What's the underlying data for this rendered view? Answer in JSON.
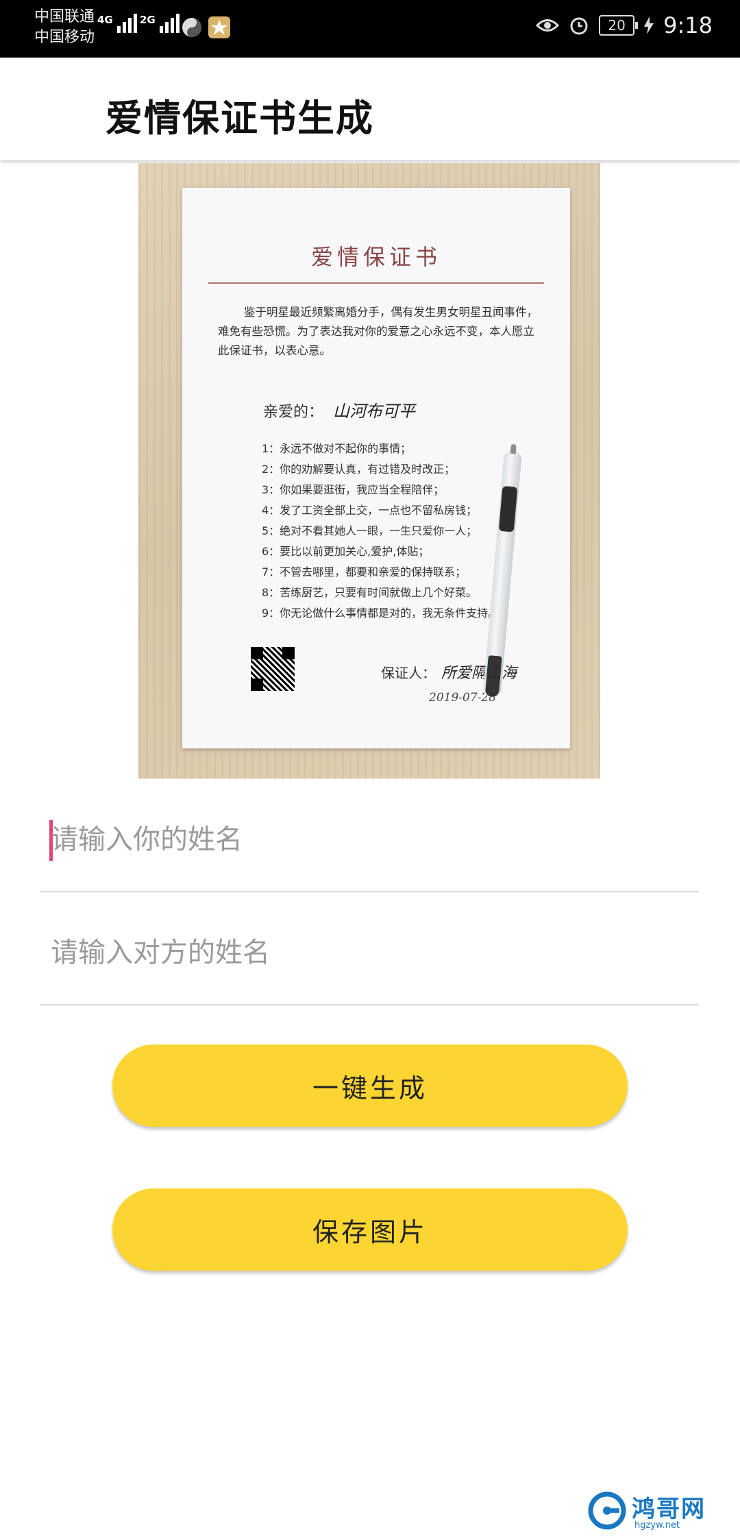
{
  "status_bar": {
    "carrier_1": "中国联通",
    "carrier_2": "中国移动",
    "network_1": "4G",
    "network_2": "2G",
    "battery": "20",
    "time": "9:18",
    "icons": [
      "signal-icon",
      "vpn-icon",
      "app-notification-icon",
      "eye-comfort-icon",
      "alarm-icon",
      "battery-icon",
      "charging-icon"
    ]
  },
  "app_bar": {
    "title": "爱情保证书生成"
  },
  "certificate": {
    "title": "爱情保证书",
    "intro": "鉴于明星最近频繁离婚分手，偶有发生男女明星丑闻事件，难免有些恐慌。为了表达我对你的爱意之心永远不变，本人愿立此保证书，以表心意。",
    "salutation": "亲爱的：",
    "partner_name": "山河布可平",
    "rules": [
      "1：永远不做对不起你的事情；",
      "2：你的劝解要认真，有过错及时改正；",
      "3：你如果要逛街，我应当全程陪伴；",
      "4：发了工资全部上交，一点也不留私房钱；",
      "5：绝对不看其她人一眼，一生只爱你一人；",
      "6：要比以前更加关心,爱护,体贴；",
      "7：不管去哪里，都要和亲爱的保持联系；",
      "8：苦练厨艺，只要有时间就做上几个好菜。",
      "9：你无论做什么事情都是对的，我无条件支持。"
    ],
    "guarantor_label": "保证人：",
    "guarantor_name": "所爱隔山海",
    "date": "2019-07-28"
  },
  "form": {
    "your_name_placeholder": "请输入你的姓名",
    "partner_name_placeholder": "请输入对方的姓名",
    "generate_label": "一键生成",
    "save_label": "保存图片"
  },
  "watermark": {
    "text": "鸿哥网",
    "url": "hgzyw.net"
  },
  "colors": {
    "accent_yellow": "#fdd532",
    "caret_pink": "#e0457b",
    "watermark_blue": "#1a78c2"
  }
}
